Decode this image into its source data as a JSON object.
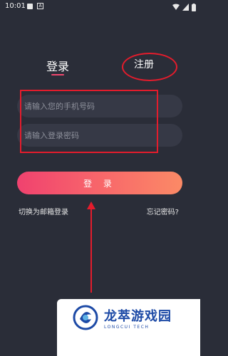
{
  "status_bar": {
    "time": "10:01",
    "notif_badge": "A"
  },
  "tabs": {
    "login": "登录",
    "register": "注册"
  },
  "form": {
    "phone_placeholder": "请输入您的手机号码",
    "password_placeholder": "请输入登录密码"
  },
  "login_button": "登 录",
  "links": {
    "switch_email": "切换为邮箱登录",
    "forgot_password": "忘记密码?"
  },
  "watermark": {
    "title": "龙萃游戏园",
    "subtitle": "LONGCUI TECH"
  },
  "colors": {
    "background": "#2a2d38",
    "accent": "#f0486e",
    "annotation": "#e41c2c",
    "field": "#363946"
  }
}
